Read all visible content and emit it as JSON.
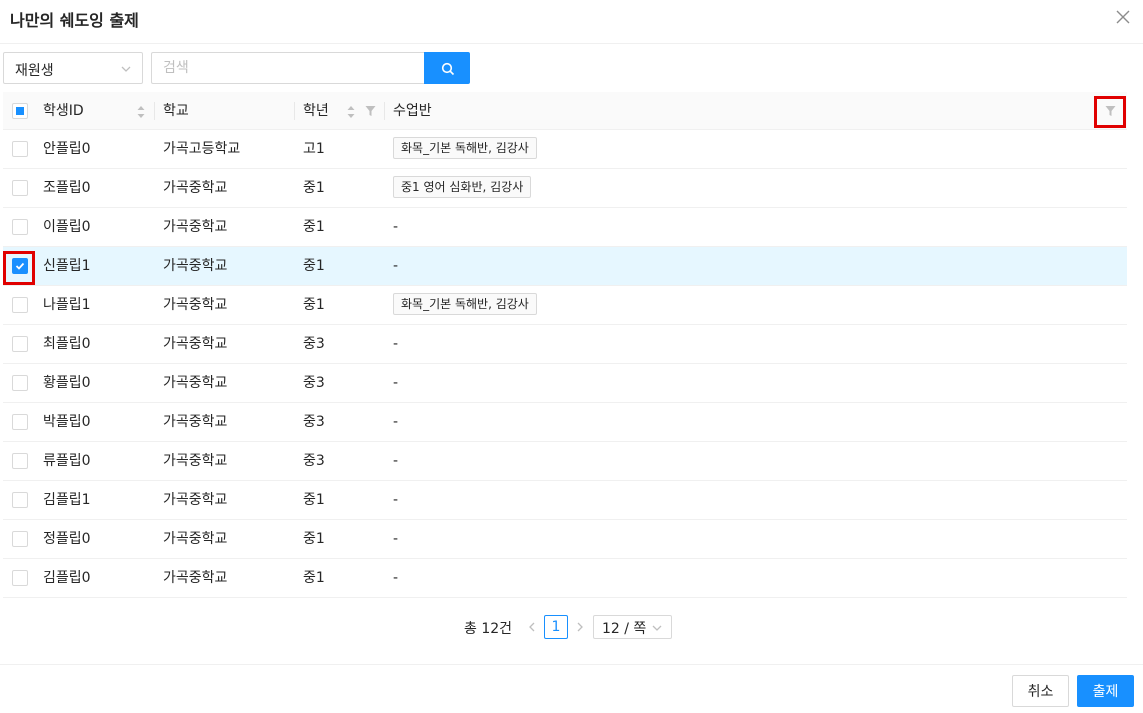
{
  "modal": {
    "title": "나만의 쉐도잉 출제"
  },
  "filter": {
    "selected": "재원생",
    "search_placeholder": "검색"
  },
  "table": {
    "columns": [
      "학생ID",
      "학교",
      "학년",
      "수업반"
    ],
    "rows": [
      {
        "id": "안플립0",
        "school": "가곡고등학교",
        "grade": "고1",
        "class": "화목_기본 독해반, 김강사",
        "checked": false
      },
      {
        "id": "조플립0",
        "school": "가곡중학교",
        "grade": "중1",
        "class": "중1 영어 심화반, 김강사",
        "checked": false
      },
      {
        "id": "이플립0",
        "school": "가곡중학교",
        "grade": "중1",
        "class": "-",
        "checked": false
      },
      {
        "id": "신플립1",
        "school": "가곡중학교",
        "grade": "중1",
        "class": "-",
        "checked": true
      },
      {
        "id": "나플립1",
        "school": "가곡중학교",
        "grade": "중1",
        "class": "화목_기본 독해반, 김강사",
        "checked": false
      },
      {
        "id": "최플립0",
        "school": "가곡중학교",
        "grade": "중3",
        "class": "-",
        "checked": false
      },
      {
        "id": "황플립0",
        "school": "가곡중학교",
        "grade": "중3",
        "class": "-",
        "checked": false
      },
      {
        "id": "박플립0",
        "school": "가곡중학교",
        "grade": "중3",
        "class": "-",
        "checked": false
      },
      {
        "id": "류플립0",
        "school": "가곡중학교",
        "grade": "중3",
        "class": "-",
        "checked": false
      },
      {
        "id": "김플립1",
        "school": "가곡중학교",
        "grade": "중1",
        "class": "-",
        "checked": false
      },
      {
        "id": "정플립0",
        "school": "가곡중학교",
        "grade": "중1",
        "class": "-",
        "checked": false
      },
      {
        "id": "김플립0",
        "school": "가곡중학교",
        "grade": "중1",
        "class": "-",
        "checked": false
      }
    ]
  },
  "pagination": {
    "total": "총 12건",
    "current_page": "1",
    "page_size": "12 / 쪽"
  },
  "footer": {
    "cancel_label": "취소",
    "submit_label": "출제"
  },
  "colors": {
    "accent": "#1890ff",
    "highlight": "#e00000",
    "selected_row": "#e6f7ff"
  }
}
